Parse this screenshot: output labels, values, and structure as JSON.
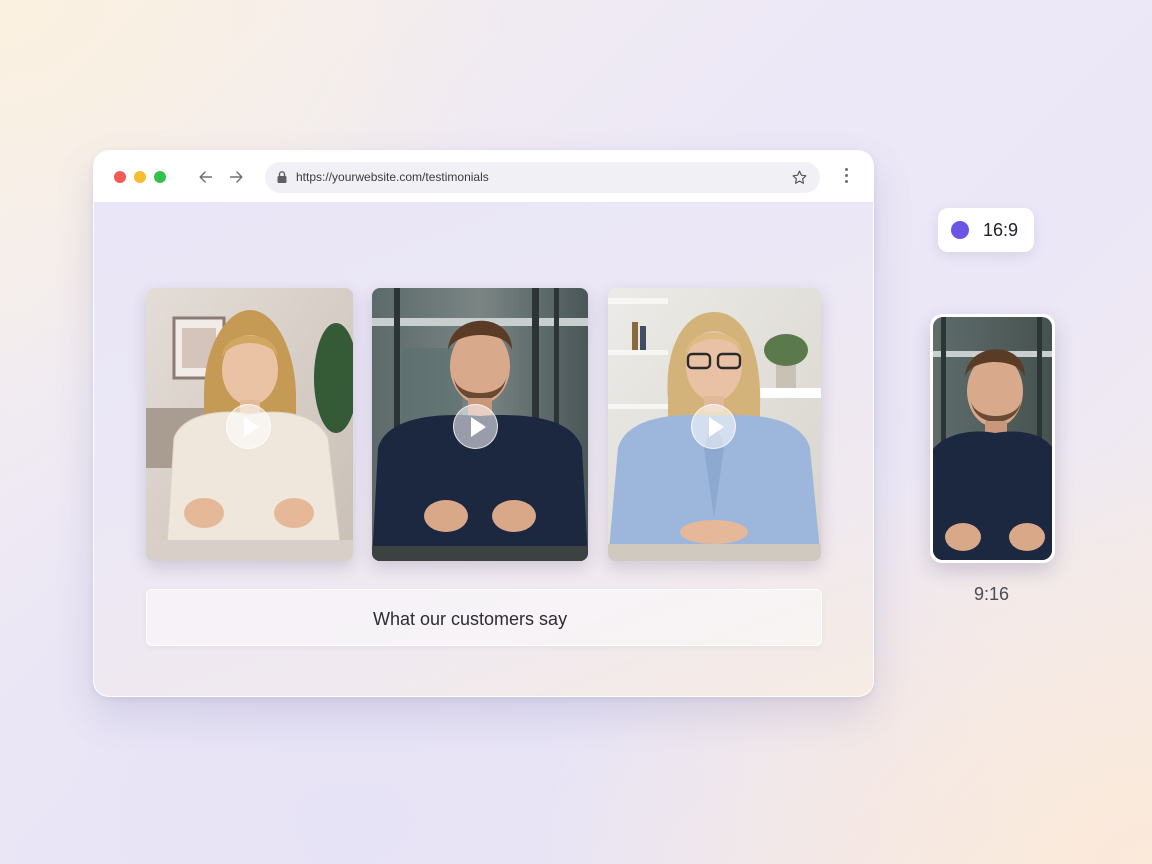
{
  "browser": {
    "url": "https://yourwebsite.com/testimonials",
    "icons": {
      "back": "arrow-left-icon",
      "forward": "arrow-right-icon",
      "lock": "lock-icon",
      "bookmark": "star-icon",
      "menu": "vertical-dots-icon"
    }
  },
  "testimonials": {
    "videos": [
      {
        "name": "testimonial-video-woman-sweater",
        "control": "play-icon"
      },
      {
        "name": "testimonial-video-man-navy-sweater",
        "control": "play-icon"
      },
      {
        "name": "testimonial-video-woman-glasses",
        "control": "play-icon"
      }
    ],
    "caption": "What our customers say"
  },
  "aspect": {
    "landscape_label": "16:9",
    "portrait_label": "9:16",
    "accent": "#6b55e6"
  }
}
